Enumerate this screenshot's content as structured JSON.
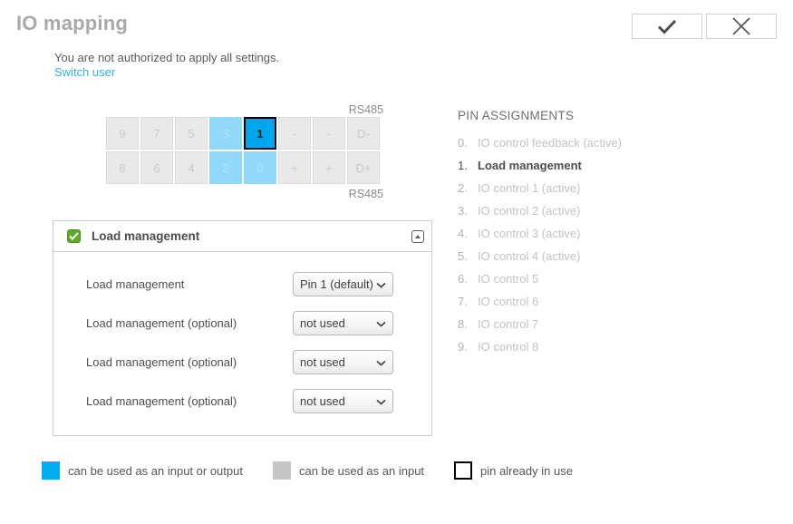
{
  "header": {
    "title": "IO mapping",
    "apply_button": "apply",
    "cancel_button": "cancel",
    "notice": "You are not authorized to apply all settings.",
    "switch_user_link": "Switch user"
  },
  "pin_grid": {
    "label_top": "RS485",
    "label_bottom": "RS485",
    "rows": [
      [
        {
          "label": "9",
          "state": "in-use"
        },
        {
          "label": "7",
          "state": "in-use"
        },
        {
          "label": "5",
          "state": "in-use"
        },
        {
          "label": "3",
          "state": "available"
        },
        {
          "label": "1",
          "state": "selected"
        },
        {
          "label": "-",
          "state": "in-use"
        },
        {
          "label": "-",
          "state": "in-use"
        },
        {
          "label": "D-",
          "state": "in-use"
        }
      ],
      [
        {
          "label": "8",
          "state": "in-use"
        },
        {
          "label": "6",
          "state": "in-use"
        },
        {
          "label": "4",
          "state": "in-use"
        },
        {
          "label": "2",
          "state": "available"
        },
        {
          "label": "0",
          "state": "available"
        },
        {
          "label": "+",
          "state": "in-use"
        },
        {
          "label": "+",
          "state": "in-use"
        },
        {
          "label": "D+",
          "state": "in-use"
        }
      ]
    ]
  },
  "panel": {
    "checkbox_checked": true,
    "title": "Load management",
    "collapse_icon": "collapse-icon",
    "rows": [
      {
        "label": "Load management",
        "value": "Pin 1 (default)"
      },
      {
        "label": "Load management (optional)",
        "value": "not used"
      },
      {
        "label": "Load management (optional)",
        "value": "not used"
      },
      {
        "label": "Load management (optional)",
        "value": "not used"
      }
    ]
  },
  "assignments": {
    "title": "PIN ASSIGNMENTS",
    "items": [
      {
        "num": "0.",
        "label": "IO control feedback (active)",
        "active": false
      },
      {
        "num": "1.",
        "label": "Load management",
        "active": true
      },
      {
        "num": "2.",
        "label": "IO control 1 (active)",
        "active": false
      },
      {
        "num": "3.",
        "label": "IO control 2 (active)",
        "active": false
      },
      {
        "num": "4.",
        "label": "IO control 3 (active)",
        "active": false
      },
      {
        "num": "5.",
        "label": "IO control 4 (active)",
        "active": false
      },
      {
        "num": "6.",
        "label": "IO control 5",
        "active": false
      },
      {
        "num": "7.",
        "label": "IO control 6",
        "active": false
      },
      {
        "num": "8.",
        "label": "IO control 7",
        "active": false
      },
      {
        "num": "9.",
        "label": "IO control 8",
        "active": false
      }
    ]
  },
  "legend": {
    "items": [
      {
        "label": "can be used as an input or output",
        "color": "#00aeef"
      },
      {
        "label": "can be used as an input",
        "color": "#c6c6c6"
      },
      {
        "label": "pin already in use",
        "color": "#ffffff"
      }
    ]
  },
  "colors": {
    "accent_blue": "#00a7ee",
    "available_blue": "#91d8fb",
    "in_use_gray": "#e9e9e9",
    "link_blue": "#35b0ea",
    "checkbox_green": "#5faa27"
  }
}
